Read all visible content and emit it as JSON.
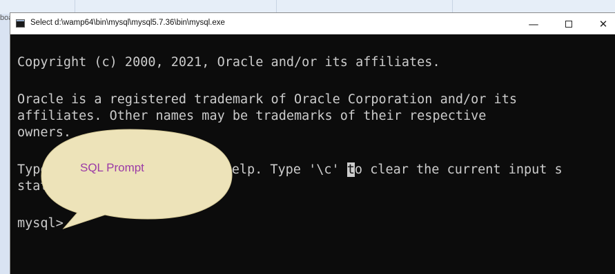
{
  "background": {
    "partial_label": "boa"
  },
  "window": {
    "title": "Select d:\\wamp64\\bin\\mysql\\mysql5.7.36\\bin\\mysql.exe",
    "minimize_glyph": "—",
    "close_glyph": "✕"
  },
  "console": {
    "lines": [
      "Copyright (c) 2000, 2021, Oracle and/or its affiliates.",
      "Oracle is a registered trademark of Oracle Corporation and/or its",
      "affiliates. Other names may be trademarks of their respective",
      "owners.",
      "Type",
      "state",
      "mysql>"
    ],
    "help_line_visible_tail": "help. Type '\\c' ",
    "cursor_char": "t",
    "help_line_after_cursor": "o clear the current input s",
    "fg_color": "#cccccc",
    "bg_color": "#0c0c0c"
  },
  "callout": {
    "label": "SQL Prompt",
    "fill_color": "#ede3b9",
    "text_color": "#9b3aa6"
  }
}
